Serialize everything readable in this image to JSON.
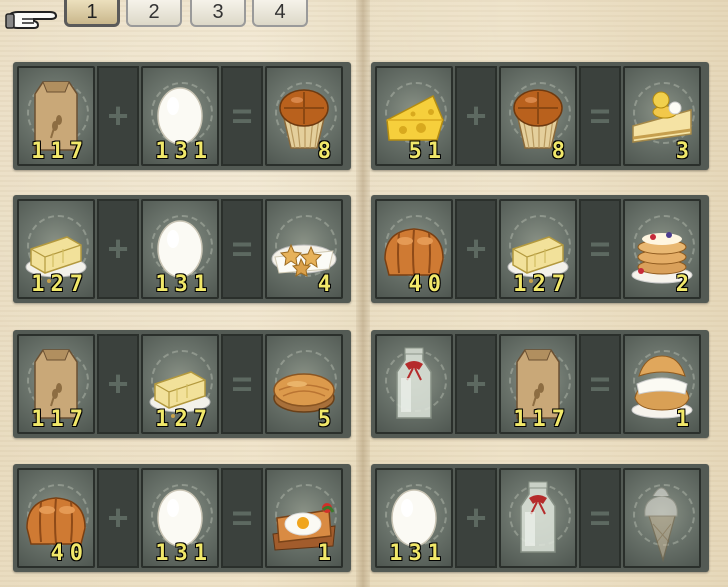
{
  "tabs": [
    "1",
    "2",
    "3",
    "4"
  ],
  "active_tab": 0,
  "recipes": [
    {
      "a": {
        "item": "flour-sack",
        "count": "117"
      },
      "b": {
        "item": "egg",
        "count": "131"
      },
      "op1": "+",
      "op2": "=",
      "result": {
        "item": "muffin",
        "count": "8"
      }
    },
    {
      "a": {
        "item": "cheese",
        "count": "51"
      },
      "b": {
        "item": "muffin",
        "count": "8"
      },
      "op1": "+",
      "op2": "=",
      "result": {
        "item": "cheesecake-slice",
        "count": "3"
      }
    },
    {
      "a": {
        "item": "butter",
        "count": "127"
      },
      "b": {
        "item": "egg",
        "count": "131"
      },
      "op1": "+",
      "op2": "=",
      "result": {
        "item": "star-cookies",
        "count": "4"
      }
    },
    {
      "a": {
        "item": "bread-loaf",
        "count": "40"
      },
      "b": {
        "item": "butter",
        "count": "127"
      },
      "op1": "+",
      "op2": "=",
      "result": {
        "item": "pancake-stack",
        "count": "2"
      }
    },
    {
      "a": {
        "item": "flour-sack",
        "count": "117"
      },
      "b": {
        "item": "butter",
        "count": "127"
      },
      "op1": "+",
      "op2": "=",
      "result": {
        "item": "pie",
        "count": "5"
      }
    },
    {
      "a": {
        "item": "milk-bottle",
        "count": ""
      },
      "b": {
        "item": "flour-sack",
        "count": "117"
      },
      "op1": "+",
      "op2": "=",
      "result": {
        "item": "cream-puff",
        "count": "1"
      }
    },
    {
      "a": {
        "item": "bread-loaf",
        "count": "40"
      },
      "b": {
        "item": "egg",
        "count": "131"
      },
      "op1": "+",
      "op2": "=",
      "result": {
        "item": "egg-toast",
        "count": "1"
      }
    },
    {
      "a": {
        "item": "egg",
        "count": "131"
      },
      "b": {
        "item": "milk-bottle",
        "count": ""
      },
      "op1": "+",
      "op2": "=",
      "result": {
        "item": "ice-cream-cone",
        "count": ""
      }
    }
  ]
}
